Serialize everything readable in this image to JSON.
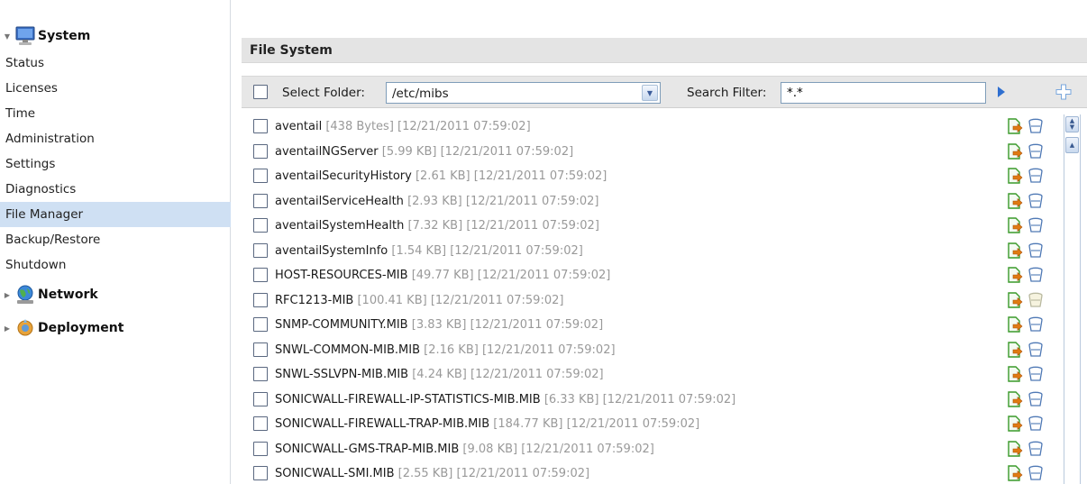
{
  "sidebar": {
    "groups": [
      {
        "label": "System",
        "icon": "monitor-icon",
        "expanded": true
      },
      {
        "label": "Network",
        "icon": "network-globe-icon",
        "expanded": false
      },
      {
        "label": "Deployment",
        "icon": "deployment-icon",
        "expanded": false
      }
    ],
    "items": [
      {
        "label": "Status"
      },
      {
        "label": "Licenses"
      },
      {
        "label": "Time"
      },
      {
        "label": "Administration"
      },
      {
        "label": "Settings"
      },
      {
        "label": "Diagnostics"
      },
      {
        "label": "File Manager",
        "active": true
      },
      {
        "label": "Backup/Restore"
      },
      {
        "label": "Shutdown"
      }
    ]
  },
  "main": {
    "title": "File System",
    "toolbar": {
      "select_folder_label": "Select Folder:",
      "folder_value": "/etc/mibs",
      "search_filter_label": "Search Filter:",
      "search_filter_value": "*.*"
    },
    "files": [
      {
        "name": "aventail",
        "size": "[438 Bytes]",
        "date": "[12/21/2011 07:59:02]"
      },
      {
        "name": "aventailNGServer",
        "size": "[5.99 KB]",
        "date": "[12/21/2011 07:59:02]"
      },
      {
        "name": "aventailSecurityHistory",
        "size": "[2.61 KB]",
        "date": "[12/21/2011 07:59:02]"
      },
      {
        "name": "aventailServiceHealth",
        "size": "[2.93 KB]",
        "date": "[12/21/2011 07:59:02]"
      },
      {
        "name": "aventailSystemHealth",
        "size": "[7.32 KB]",
        "date": "[12/21/2011 07:59:02]"
      },
      {
        "name": "aventailSystemInfo",
        "size": "[1.54 KB]",
        "date": "[12/21/2011 07:59:02]"
      },
      {
        "name": "HOST-RESOURCES-MIB",
        "size": "[49.77 KB]",
        "date": "[12/21/2011 07:59:02]"
      },
      {
        "name": "RFC1213-MIB",
        "size": "[100.41 KB]",
        "date": "[12/21/2011 07:59:02]",
        "delete_disabled": true
      },
      {
        "name": "SNMP-COMMUNITY.MIB",
        "size": "[3.83 KB]",
        "date": "[12/21/2011 07:59:02]"
      },
      {
        "name": "SNWL-COMMON-MIB.MIB",
        "size": "[2.16 KB]",
        "date": "[12/21/2011 07:59:02]"
      },
      {
        "name": "SNWL-SSLVPN-MIB.MIB",
        "size": "[4.24 KB]",
        "date": "[12/21/2011 07:59:02]"
      },
      {
        "name": "SONICWALL-FIREWALL-IP-STATISTICS-MIB.MIB",
        "size": "[6.33 KB]",
        "date": "[12/21/2011 07:59:02]"
      },
      {
        "name": "SONICWALL-FIREWALL-TRAP-MIB.MIB",
        "size": "[184.77 KB]",
        "date": "[12/21/2011 07:59:02]"
      },
      {
        "name": "SONICWALL-GMS-TRAP-MIB.MIB",
        "size": "[9.08 KB]",
        "date": "[12/21/2011 07:59:02]"
      },
      {
        "name": "SONICWALL-SMI.MIB",
        "size": "[2.55 KB]",
        "date": "[12/21/2011 07:59:02]"
      }
    ]
  },
  "colors": {
    "selected_item_bg": "#cfe0f3",
    "title_bar_bg": "#e4e4e4",
    "meta_text": "#999999",
    "download_icon_green": "#3a9a2a",
    "download_icon_orange": "#e07a12",
    "delete_icon_blue": "#4f79b5"
  }
}
